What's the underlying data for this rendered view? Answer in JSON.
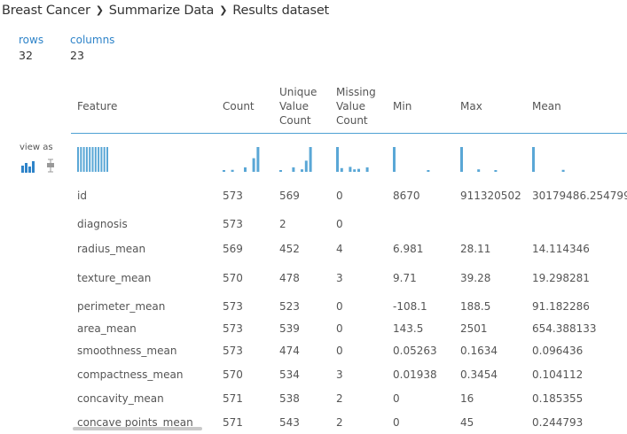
{
  "breadcrumb": [
    "Breast Cancer",
    "Summarize Data",
    "Results dataset"
  ],
  "stats": {
    "rows_label": "rows",
    "rows_value": "32",
    "columns_label": "columns",
    "columns_value": "23"
  },
  "view_as_label": "view as",
  "columns": [
    "Feature",
    "Count",
    "Unique Value Count",
    "Missing Value Count",
    "Min",
    "Max",
    "Mean"
  ],
  "histogram_color": "#5aa7d6",
  "histograms": {
    "feature": [
      1,
      1,
      1,
      1,
      1,
      1,
      1,
      1,
      1,
      1,
      1
    ],
    "count": [
      0.05,
      0,
      0.08,
      0,
      0,
      0.18,
      0,
      0.55,
      1
    ],
    "unique": [
      0.05,
      0,
      0,
      0.18,
      0,
      0.1,
      0.45,
      1
    ],
    "missing": [
      1,
      0.15,
      0,
      0.2,
      0.1,
      0.12,
      0,
      0.18
    ],
    "min": [
      1,
      0,
      0,
      0,
      0,
      0,
      0,
      0,
      0.05
    ],
    "max": [
      1,
      0,
      0,
      0,
      0.1,
      0,
      0,
      0,
      0.05
    ],
    "mean": [
      1,
      0,
      0,
      0,
      0,
      0,
      0,
      0.08
    ]
  },
  "rows": [
    {
      "feature": "id",
      "count": "573",
      "unique": "569",
      "missing": "0",
      "min": "8670",
      "max": "911320502",
      "mean": "30179486.254799"
    },
    {
      "feature": "diagnosis",
      "count": "573",
      "unique": "2",
      "missing": "0",
      "min": "",
      "max": "",
      "mean": ""
    },
    {
      "feature": "radius_mean",
      "count": "569",
      "unique": "452",
      "missing": "4",
      "min": "6.981",
      "max": "28.11",
      "mean": "14.114346"
    },
    {
      "feature": "texture_mean",
      "count": "570",
      "unique": "478",
      "missing": "3",
      "min": "9.71",
      "max": "39.28",
      "mean": "19.298281"
    },
    {
      "feature": "perimeter_mean",
      "count": "573",
      "unique": "523",
      "missing": "0",
      "min": "-108.1",
      "max": "188.5",
      "mean": "91.182286"
    },
    {
      "feature": "area_mean",
      "count": "573",
      "unique": "539",
      "missing": "0",
      "min": "143.5",
      "max": "2501",
      "mean": "654.388133"
    },
    {
      "feature": "smoothness_mean",
      "count": "573",
      "unique": "474",
      "missing": "0",
      "min": "0.05263",
      "max": "0.1634",
      "mean": "0.096436"
    },
    {
      "feature": "compactness_mean",
      "count": "570",
      "unique": "534",
      "missing": "3",
      "min": "0.01938",
      "max": "0.3454",
      "mean": "0.104112"
    },
    {
      "feature": "concavity_mean",
      "count": "571",
      "unique": "538",
      "missing": "2",
      "min": "0",
      "max": "16",
      "mean": "0.185355"
    },
    {
      "feature": "concave points_mean",
      "count": "571",
      "unique": "543",
      "missing": "2",
      "min": "0",
      "max": "45",
      "mean": "0.244793"
    }
  ]
}
